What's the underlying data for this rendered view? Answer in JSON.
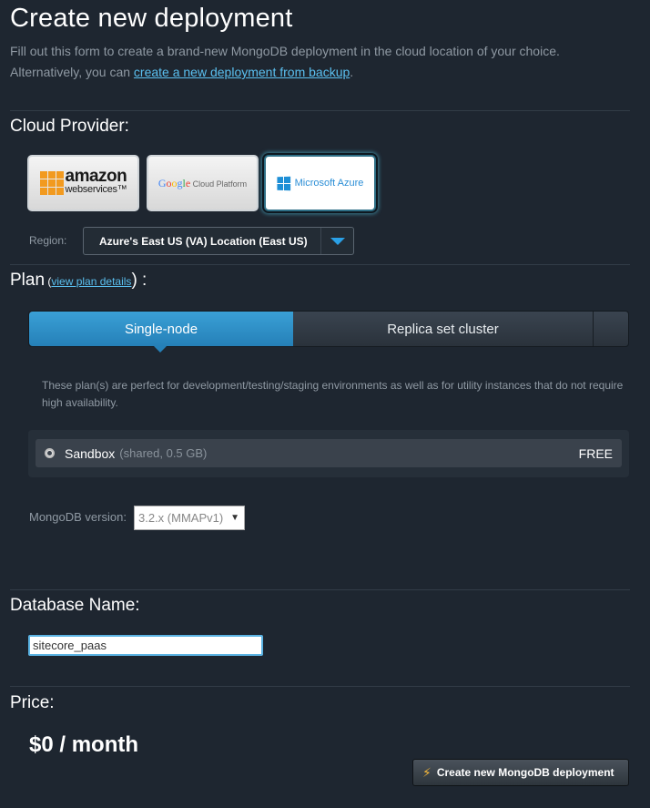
{
  "header": {
    "title": "Create new deployment",
    "intro_line1": "Fill out this form to create a brand-new MongoDB deployment in the cloud location of your choice.",
    "intro_line2_prefix": "Alternatively, you can ",
    "intro_link": "create a new deployment from backup",
    "intro_line2_suffix": "."
  },
  "cloud": {
    "title": "Cloud Provider:",
    "providers": [
      {
        "name": "amazon",
        "line1": "amazon",
        "line2": "webservices",
        "tm": "™"
      },
      {
        "name": "google",
        "g": [
          "G",
          "o",
          "o",
          "g",
          "l",
          "e"
        ],
        "rest": " Cloud Platform"
      },
      {
        "name": "azure",
        "label": "Microsoft Azure",
        "selected": true
      }
    ],
    "region_label": "Region:",
    "region_value": "Azure's East US (VA) Location (East US)"
  },
  "plan": {
    "title": "Plan",
    "paren_open": " (",
    "details_link": "view plan details",
    "paren_close": ") :",
    "tabs": [
      {
        "label": "Single-node",
        "active": true
      },
      {
        "label": "Replica set cluster",
        "active": false
      }
    ],
    "description": "These plan(s) are perfect for development/testing/staging environments as well as for utility instances that do not require high availability.",
    "option": {
      "name": "Sandbox",
      "detail": "(shared, 0.5 GB)",
      "price": "FREE"
    },
    "version_label": "MongoDB version:",
    "version_value": "3.2.x (MMAPv1)"
  },
  "database": {
    "title": "Database Name:",
    "value": "sitecore_paas"
  },
  "price": {
    "title": "Price:",
    "value": "$0 / month"
  },
  "actions": {
    "create_label": "Create new MongoDB deployment"
  },
  "colors": {
    "accent": "#2a8fcd",
    "background": "#1e2630",
    "link": "#5bc0f0",
    "bolt": "#f3b63a"
  }
}
